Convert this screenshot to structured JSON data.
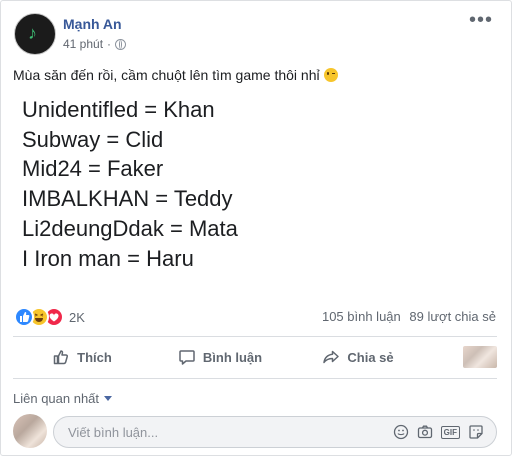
{
  "post": {
    "author": "Mạnh An",
    "time": "41 phút",
    "caption": "Mùa săn đến rồi, cầm chuột lên tìm game thôi nhỉ",
    "lines": [
      "Unidentifled = Khan",
      "Subway = Clid",
      "Mid24 = Faker",
      "IMBALKHAN = Teddy",
      "Li2deungDdak = Mata",
      "I Iron man = Haru"
    ],
    "more_icon": "ellipsis-icon",
    "privacy_icon": "globe-icon",
    "caption_emoji": "wink-emoji-icon"
  },
  "stats": {
    "reaction_count": "2K",
    "reaction_icons": [
      "like-reaction-icon",
      "haha-reaction-icon",
      "love-reaction-icon"
    ],
    "comments": "105 bình luận",
    "shares": "89 lượt chia sẻ"
  },
  "actions": {
    "like": "Thích",
    "comment": "Bình luận",
    "share": "Chia sẻ"
  },
  "comments": {
    "sort_label": "Liên quan nhất",
    "placeholder": "Viết bình luận...",
    "input_icons": [
      "emoji-icon",
      "camera-icon",
      "gif-icon",
      "sticker-icon"
    ]
  },
  "colors": {
    "link": "#385898",
    "muted": "#606770",
    "like_blue": "#2d88ff",
    "love_red": "#f0284a",
    "haha_yellow": "#f7c52b"
  }
}
